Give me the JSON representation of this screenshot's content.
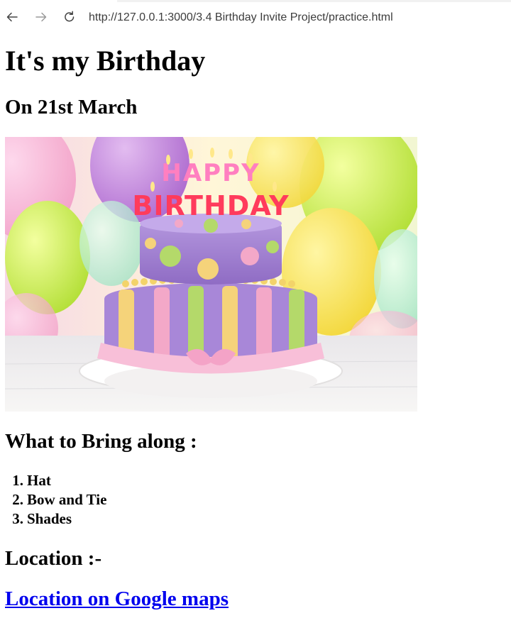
{
  "browser": {
    "url": "http://127.0.0.1:3000/3.4 Birthday Invite Project/practice.html"
  },
  "page": {
    "title": "It's my Birthday",
    "date_heading": "On 21st March",
    "image": {
      "alt": "HAPPY BIRTHDAY cake with balloons",
      "candle_text_top": "HAPPY",
      "candle_text_bottom": "BIRTHDAY"
    },
    "bring_heading": "What to Bring along :",
    "bring_items": [
      {
        "num": "1.",
        "label": "Hat"
      },
      {
        "num": "2.",
        "label": "Bow and Tie"
      },
      {
        "num": "3.",
        "label": "Shades"
      }
    ],
    "location_heading": "Location :-",
    "location_link": "Location on Google maps"
  },
  "colors": {
    "link": "#0000ee",
    "text": "#000000",
    "url_text": "#3c3c3c"
  },
  "icons": [
    "back-arrow-icon",
    "forward-arrow-icon",
    "reload-icon"
  ]
}
